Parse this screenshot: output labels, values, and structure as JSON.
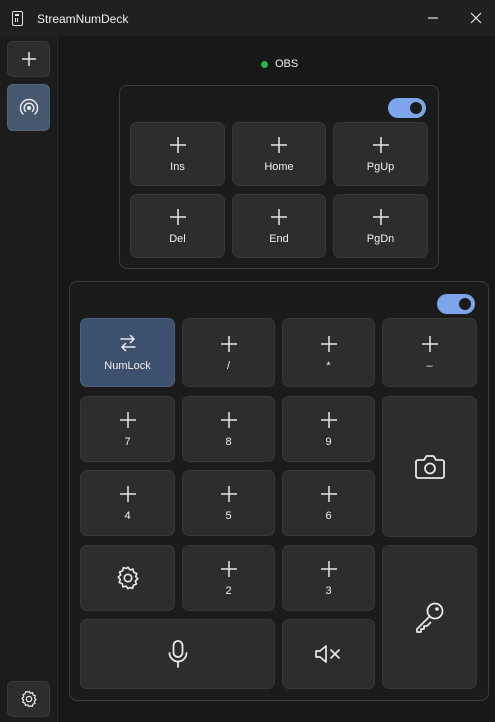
{
  "app": {
    "title": "StreamNumDeck"
  },
  "status": {
    "label": "OBS",
    "color": "#2db34a"
  },
  "accent": "#7ea4ec",
  "nav_panel": {
    "toggle_on": true,
    "keys": [
      "Ins",
      "Home",
      "PgUp",
      "Del",
      "End",
      "PgDn"
    ]
  },
  "numpad_panel": {
    "toggle_on": true,
    "numlock_label": "NumLock",
    "keys": {
      "div": "/",
      "mul": "*",
      "minus": "–",
      "k7": "7",
      "k8": "8",
      "k9": "9",
      "k4": "4",
      "k5": "5",
      "k6": "6",
      "k2": "2",
      "k3": "3"
    },
    "icon_keys": [
      "camera-icon",
      "gear-icon",
      "key-icon",
      "microphone-icon",
      "mute-icon"
    ]
  }
}
